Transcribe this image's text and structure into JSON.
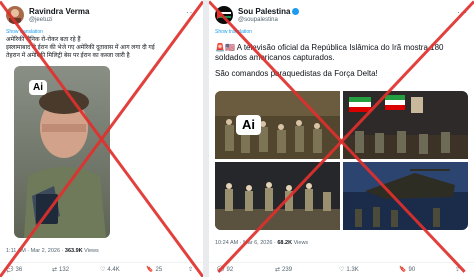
{
  "left_post": {
    "display_name": "Ravindra Verma",
    "handle": "@jeetuzi",
    "translate_label": "Show translation",
    "text_lines": [
      "अमेरिकी सैनिक रो-रोकर बता रहे हैं",
      "इस्लामाबाद से ईरान की भेजे गए अमेरिकी दूतावास में आग लगा दी गई",
      "तेहरान में अमेरिकी मिलिट्री बेस पर ईरान का कब्जा जारी है"
    ],
    "ai_badge": "Ai",
    "timestamp": "1:11 AM · Mar 2, 2026 · ",
    "views_count": "363.9K",
    "views_label": " Views",
    "actions": {
      "replies": "36",
      "reposts": "132",
      "likes": "4.4K",
      "bookmarks": "25"
    }
  },
  "right_post": {
    "display_name": "Sou Palestina",
    "handle": "@soupalestina",
    "translate_label": "Show translation",
    "line1_prefix": "🚨🇺🇸",
    "line1_text": "A televisão oficial da República Islâmica do Irã mostra 180",
    "line2_text": "soldados americanos capturados.",
    "line3_text": "São comandos paraquedistas da Força Delta!",
    "ai_badge": "Ai",
    "timestamp": "10:24 AM · Mar 6, 2026 · ",
    "views_count": "68.2K",
    "views_label": " Views",
    "actions": {
      "replies": "92",
      "reposts": "239",
      "likes": "1.3K",
      "bookmarks": "90"
    }
  },
  "colors": {
    "cross_red": "#e0302c",
    "link_blue": "#1d9bf0",
    "muted": "#536471"
  }
}
